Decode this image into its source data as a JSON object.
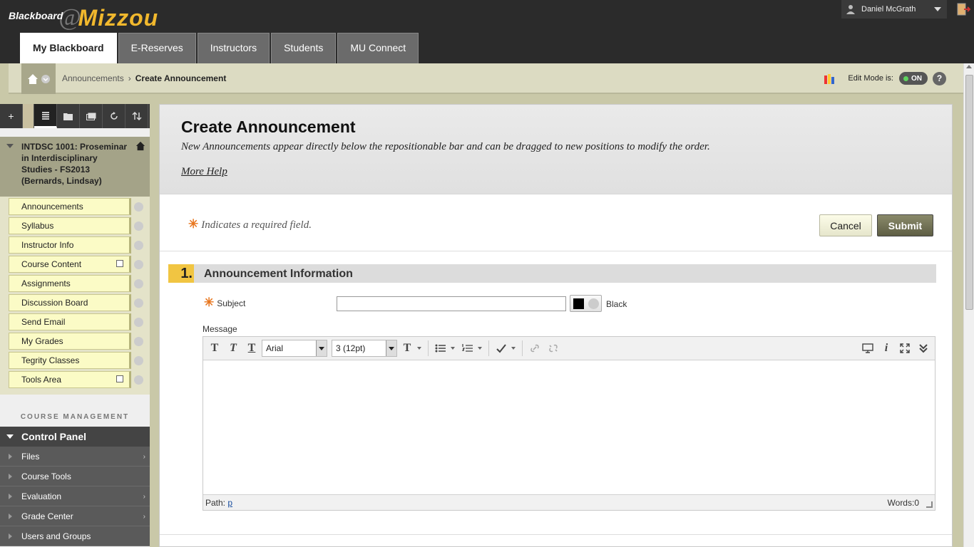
{
  "brand": {
    "part1": "Blackboard",
    "part2": "@",
    "part3": "Mizzou"
  },
  "user": {
    "name": "Daniel McGrath"
  },
  "tabs": [
    {
      "label": "My Blackboard",
      "active": true
    },
    {
      "label": "E-Reserves",
      "active": false
    },
    {
      "label": "Instructors",
      "active": false
    },
    {
      "label": "Students",
      "active": false
    },
    {
      "label": "MU Connect",
      "active": false
    }
  ],
  "breadcrumb": {
    "parent": "Announcements",
    "separator": "›",
    "current": "Create Announcement"
  },
  "edit_mode": {
    "label": "Edit Mode is:",
    "state": "ON"
  },
  "help_label": "?",
  "course": {
    "title": "INTDSC 1001: Proseminar in Interdisciplinary Studies - FS2013 (Bernards, Lindsay)"
  },
  "course_menu": [
    "Announcements",
    "Syllabus",
    "Instructor Info",
    "Course Content",
    "Assignments",
    "Discussion Board",
    "Send Email",
    "My Grades",
    "Tegrity Classes",
    "Tools Area"
  ],
  "course_management": {
    "heading": "COURSE MANAGEMENT",
    "control_panel": "Control Panel",
    "items": [
      "Files",
      "Course Tools",
      "Evaluation",
      "Grade Center",
      "Users and Groups"
    ]
  },
  "page": {
    "title": "Create Announcement",
    "subtitle": "New Announcements appear directly below the repositionable bar and can be dragged to new positions to modify the order.",
    "more_help": "More Help",
    "required_note": "Indicates a required field.",
    "cancel": "Cancel",
    "submit": "Submit"
  },
  "section": {
    "number": "1.",
    "title": "Announcement Information"
  },
  "form": {
    "subject_label": "Subject",
    "subject_value": "",
    "color_name": "Black",
    "message_label": "Message"
  },
  "editor": {
    "font": "Arial",
    "size": "3 (12pt)",
    "path_label": "Path:",
    "path_value": "p",
    "words": "Words:0"
  },
  "colors": {
    "accent": "#f1b82d",
    "section_num": "#f1c542",
    "required": "#e8761e"
  }
}
